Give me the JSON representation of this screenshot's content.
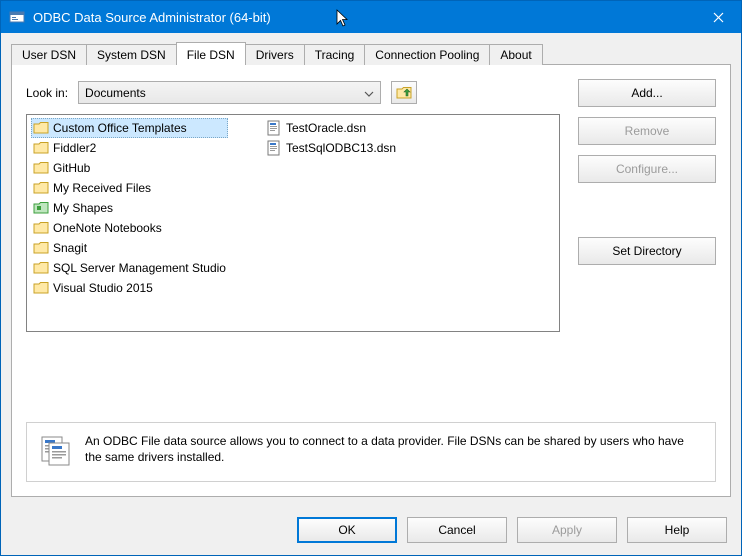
{
  "window": {
    "title": "ODBC Data Source Administrator (64-bit)"
  },
  "tabs": [
    {
      "label": "User DSN",
      "active": false
    },
    {
      "label": "System DSN",
      "active": false
    },
    {
      "label": "File DSN",
      "active": true
    },
    {
      "label": "Drivers",
      "active": false
    },
    {
      "label": "Tracing",
      "active": false
    },
    {
      "label": "Connection Pooling",
      "active": false
    },
    {
      "label": "About",
      "active": false
    }
  ],
  "lookin": {
    "label": "Look in:",
    "value": "Documents"
  },
  "files": {
    "col1": [
      {
        "name": "Custom Office Templates",
        "type": "folder",
        "selected": true
      },
      {
        "name": "Fiddler2",
        "type": "folder"
      },
      {
        "name": "GitHub",
        "type": "folder"
      },
      {
        "name": "My Received Files",
        "type": "folder"
      },
      {
        "name": "My Shapes",
        "type": "folder-green"
      },
      {
        "name": "OneNote Notebooks",
        "type": "folder"
      },
      {
        "name": "Snagit",
        "type": "folder"
      },
      {
        "name": "SQL Server Management Studio",
        "type": "folder"
      },
      {
        "name": "Visual Studio 2015",
        "type": "folder"
      }
    ],
    "col2": [
      {
        "name": "TestOracle.dsn",
        "type": "dsn"
      },
      {
        "name": "TestSqlODBC13.dsn",
        "type": "dsn"
      }
    ]
  },
  "sidebuttons": {
    "add": "Add...",
    "remove": "Remove",
    "configure": "Configure...",
    "setdir": "Set Directory"
  },
  "info": {
    "text": "An ODBC File data source allows you to connect to a data provider.  File DSNs can be shared by users who have the same drivers installed."
  },
  "footer": {
    "ok": "OK",
    "cancel": "Cancel",
    "apply": "Apply",
    "help": "Help"
  }
}
